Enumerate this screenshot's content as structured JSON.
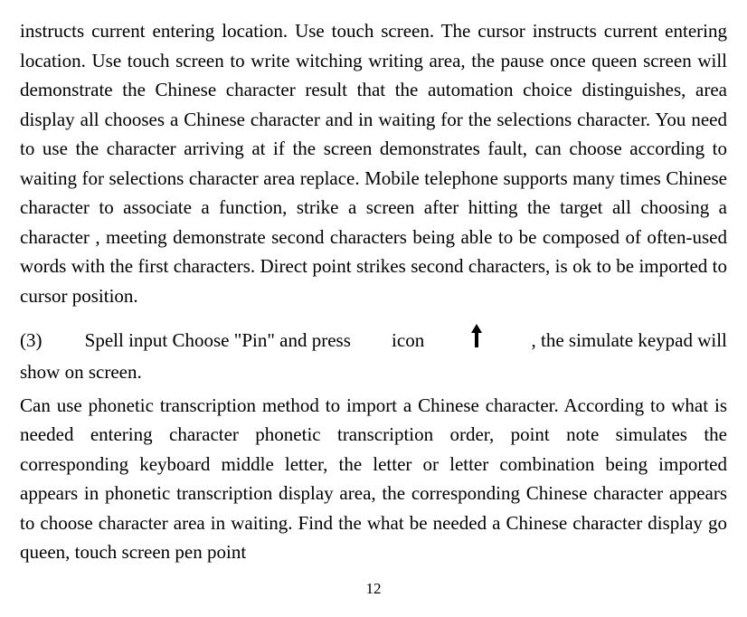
{
  "paragraph1": "instructs current entering location. Use touch screen. The cursor instructs current entering location. Use touch screen to write witching writing area, the pause once queen screen will demonstrate the Chinese character result that the automation choice distinguishes, area display all chooses a Chinese character and in waiting for the selections character. You need to use the character arriving at if the screen demonstrates fault, can choose according to waiting for selections character area replace. Mobile telephone supports many times Chinese character to associate a function, strike a screen after hitting the target all choosing a character , meeting demonstrate second characters being able to be composed of often-used words with the first characters. Direct point strikes second characters, is ok to be imported to cursor position.",
  "section3": {
    "label": "(3)",
    "before_icon": "Spell input Choose \"Pin\" and press",
    "icon_word": "icon",
    "after_icon": ", the simulate keypad will",
    "line2": "show on screen."
  },
  "paragraph3": "Can use phonetic transcription method to import a Chinese character. According to what is needed entering character phonetic transcription order, point note simulates the corresponding keyboard middle letter, the letter or letter combination being imported appears in phonetic transcription display area, the corresponding Chinese character appears to choose character area in waiting. Find the what be needed a Chinese character display go queen, touch screen pen point",
  "page_number": "12",
  "icon_name": "up-arrow-icon"
}
